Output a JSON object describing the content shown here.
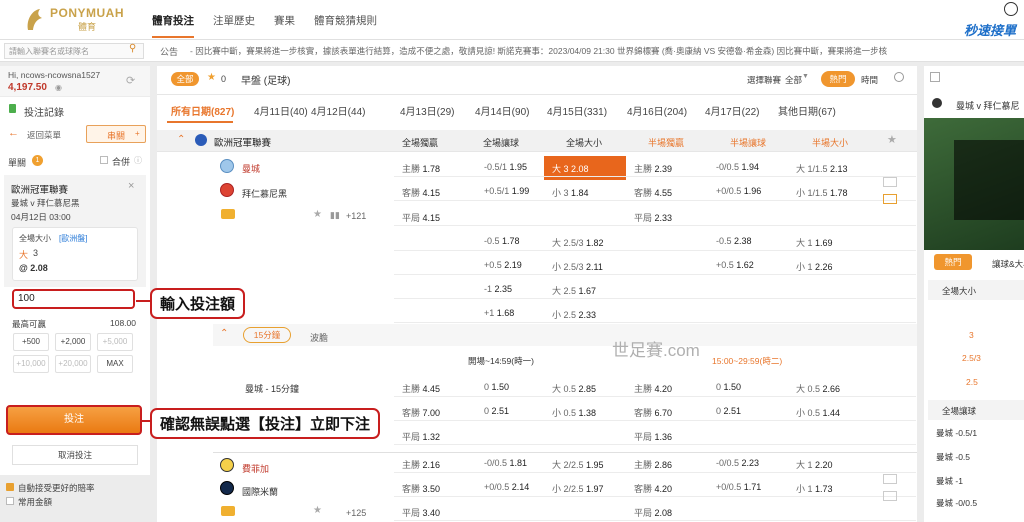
{
  "brand": {
    "name": "PONYMUAH",
    "sub": "體育"
  },
  "nav": [
    "體育投注",
    "注單歷史",
    "賽果",
    "體育競猜規則"
  ],
  "promo": "秒速接單",
  "search": {
    "placeholder": "請輸入聯賽名或球隊名"
  },
  "notice": {
    "label": "公告",
    "text": "- 因比賽中斷，賽果將進一步核實，據該表單進行結算，造成不便之處，敬請見諒!   斯諾克賽事：2023/04/09 21:30 世界錦標賽 (喬·奧康納 VS 安德魯·希金森) 因比賽中斷，賽果將進一步核"
  },
  "account": {
    "user": "Hi, ncows-ncowsna1527",
    "balance": "4,197.50"
  },
  "betslip": {
    "title": "投注記錄",
    "back": "返回菜單",
    "mode": "串關",
    "single": "單關",
    "single_count": "1",
    "merge": "合併",
    "league": "歐洲冠軍聯賽",
    "match": "曼城 v 拜仁慕尼黑",
    "date": "04月12日 03:00",
    "market": "全場大小",
    "odds_type": "[歐洲盤]",
    "pick": "大",
    "line": "3",
    "price": "@ 2.08",
    "stake": "100",
    "max_label": "最高可贏",
    "max_value": "108.00",
    "quick": [
      "+500",
      "+2,000",
      "+5,000",
      "+10,000",
      "+20,000",
      "MAX"
    ],
    "place": "投注",
    "cancel": "取消投注",
    "auto_accept": "自動接受更好的賠率",
    "common": "常用金額"
  },
  "annotations": {
    "stake": "輸入投注額",
    "confirm": "確認無誤點選【投注】立即下注"
  },
  "watermark": "世足賽.com",
  "main": {
    "filter": {
      "all": "全部",
      "fav_count": "0",
      "title": "早盤 (足球)",
      "sort_label": "選擇聯賽",
      "sort_value": "全部",
      "hot": "熱門",
      "time": "時間"
    },
    "dates": [
      {
        "label": "所有日期(827)"
      },
      {
        "label": "4月11日(40)"
      },
      {
        "label": "4月12日(44)"
      },
      {
        "label": "4月13日(29)"
      },
      {
        "label": "4月14日(90)"
      },
      {
        "label": "4月15日(331)"
      },
      {
        "label": "4月16日(204)"
      },
      {
        "label": "4月17日(22)"
      },
      {
        "label": "其他日期(67)"
      }
    ],
    "league": "歐洲冠軍聯賽",
    "columns": [
      "全場獨贏",
      "全場讓球",
      "全場大小",
      "半場獨贏",
      "半場讓球",
      "半場大小"
    ],
    "team1": "曼城",
    "team2": "拜仁慕尼黑",
    "draw": "平局",
    "more": "+121",
    "rows": [
      [
        "主勝 1.78",
        "-0.5/1 1.95",
        "大 3 2.08",
        "主勝 2.39",
        "-0/0.5 1.94",
        "大 1/1.5 2.13"
      ],
      [
        "客勝 4.15",
        "+0.5/1 1.99",
        "小 3 1.84",
        "客勝 4.55",
        "+0/0.5 1.96",
        "小 1/1.5 1.78"
      ],
      [
        "平局 4.15",
        "",
        "",
        "平局 2.33",
        "",
        ""
      ],
      [
        "",
        "-0.5 1.78",
        "大 2.5/3 1.82",
        "",
        "-0.5 2.38",
        "大 1 1.69"
      ],
      [
        "",
        "+0.5 2.19",
        "小 2.5/3 2.11",
        "",
        "+0.5 1.62",
        "小 1 2.26"
      ],
      [
        "",
        "-1 2.35",
        "大 2.5 1.67",
        "",
        "",
        ""
      ],
      [
        "",
        "+1 1.68",
        "小 2.5 2.33",
        "",
        "",
        ""
      ]
    ],
    "sub": {
      "tab1": "15分鐘",
      "tab2": "波膽",
      "period1": "開場~14:59(時一)",
      "period2": "15:00~29:59(時二)",
      "name": "曼城 - 15分鐘",
      "rows": [
        [
          "主勝 4.45",
          "0 1.50",
          "大 0.5 2.85",
          "主勝 4.20",
          "0 1.50",
          "大 0.5 2.66"
        ],
        [
          "客勝 7.00",
          "0 2.51",
          "小 0.5 1.38",
          "客勝 6.70",
          "0 2.51",
          "小 0.5 1.44"
        ],
        [
          "平局 1.32",
          "",
          "",
          "平局 1.36",
          "",
          ""
        ]
      ]
    },
    "match2": {
      "team1": "費菲加",
      "team2": "國際米蘭",
      "more": "+125",
      "rows": [
        [
          "主勝 2.16",
          "-0/0.5 1.81",
          "大 2/2.5 1.95",
          "主勝 2.86",
          "-0/0.5 2.23",
          "大 1 2.20"
        ],
        [
          "客勝 3.50",
          "+0/0.5 2.14",
          "小 2/2.5 1.97",
          "客勝 4.20",
          "+0/0.5 1.71",
          "小 1 1.73"
        ],
        [
          "平局 3.40",
          "",
          "",
          "平局 2.08",
          "",
          ""
        ]
      ]
    }
  },
  "right": {
    "teams": "曼城 v 拜仁慕尼",
    "hot": "熱門",
    "tab2": "讓球&大小",
    "sec1": "全場大小",
    "sec1_rows": [
      "3",
      "2.5/3",
      "2.5"
    ],
    "sec2": "全場讓球",
    "sec2_rows": [
      "曼城 -0.5/1",
      "曼城 -0.5",
      "曼城 -1",
      "曼城 -0/0.5"
    ]
  }
}
